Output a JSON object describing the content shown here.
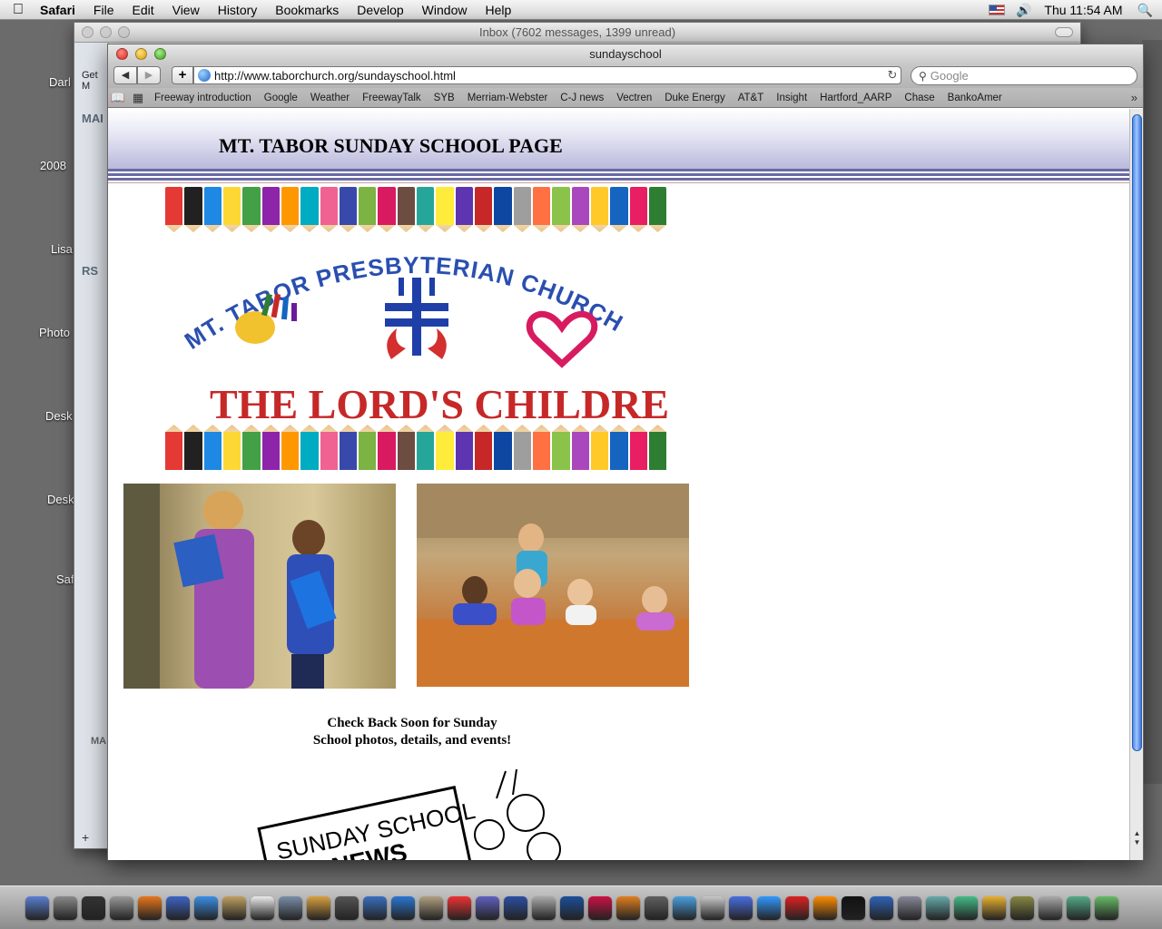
{
  "menubar": {
    "app": "Safari",
    "items": [
      "File",
      "Edit",
      "View",
      "History",
      "Bookmarks",
      "Develop",
      "Window",
      "Help"
    ],
    "clock": "Thu 11:54 AM"
  },
  "desktop_labels": [
    "Darl",
    "2008",
    "Lisa",
    "Photo",
    "Desk",
    "Desk",
    "Saf"
  ],
  "mail_window": {
    "title": "Inbox (7602 messages, 1399 unread)",
    "get_mail": "Get M",
    "section_mailboxes": "MAI",
    "section_rss": "RS",
    "section_bottom": "MA"
  },
  "safari": {
    "title": "sundayschool",
    "url": "http://www.taborchurch.org/sundayschool.html",
    "search_placeholder": "Google",
    "bookmarks": [
      "Freeway introduction",
      "Google",
      "Weather",
      "FreewayTalk",
      "SYB",
      "Merriam-Webster",
      "C-J news",
      "Vectren",
      "Duke Energy",
      "AT&T",
      "Insight",
      "Hartford_AARP",
      "Chase",
      "BankoAmer"
    ]
  },
  "page": {
    "title": "MT. TABOR SUNDAY SCHOOL PAGE",
    "banner_arc": "MT. TABOR PRESBYTERIAN CHURCH",
    "banner_slogan": "THE LORD'S CHILDREN",
    "caption_line1": "Check Back Soon for Sunday",
    "caption_line2": "School photos, details, and events!",
    "clipart_line1": "SUNDAY SCHOOL",
    "clipart_line2": "NEWS"
  },
  "colors": {
    "header_band": "#b9b9dc",
    "rule": "#6a6aa5",
    "scroll_thumb": "#4d8ae8"
  },
  "pencil_colors": [
    "#e53935",
    "#212121",
    "#1e88e5",
    "#fdd835",
    "#43a047",
    "#8e24aa",
    "#ff9800",
    "#00acc1",
    "#f06292",
    "#3949ab",
    "#7cb342",
    "#d81b60",
    "#6d4c41",
    "#26a69a",
    "#ffeb3b",
    "#5e35b1",
    "#c62828",
    "#0d47a1",
    "#9e9e9e",
    "#ff7043",
    "#8bc34a",
    "#ab47bc",
    "#ffca28",
    "#1565c0",
    "#e91e63",
    "#2e7d32"
  ],
  "dock_colors": [
    "#5a7fd1",
    "#8a8a8a",
    "#333",
    "#999",
    "#e8761c",
    "#3e64c4",
    "#3a8ee6",
    "#c0a060",
    "#eaeaea",
    "#7a8fa8",
    "#d8a040",
    "#555",
    "#3a6ec0",
    "#2b76d2",
    "#b0a080",
    "#e33",
    "#6060c0",
    "#2d4fa1",
    "#aaa",
    "#1c4f9a",
    "#c14",
    "#e08020",
    "#606060",
    "#4aa0e0",
    "#c8c8c8",
    "#4a6ee0",
    "#3399ff",
    "#d22",
    "#ff8c00",
    "#111",
    "#2f63b8",
    "#889",
    "#6aa",
    "#4b8",
    "#e8b030",
    "#884",
    "#aaa",
    "#5a8",
    "#6b6"
  ]
}
